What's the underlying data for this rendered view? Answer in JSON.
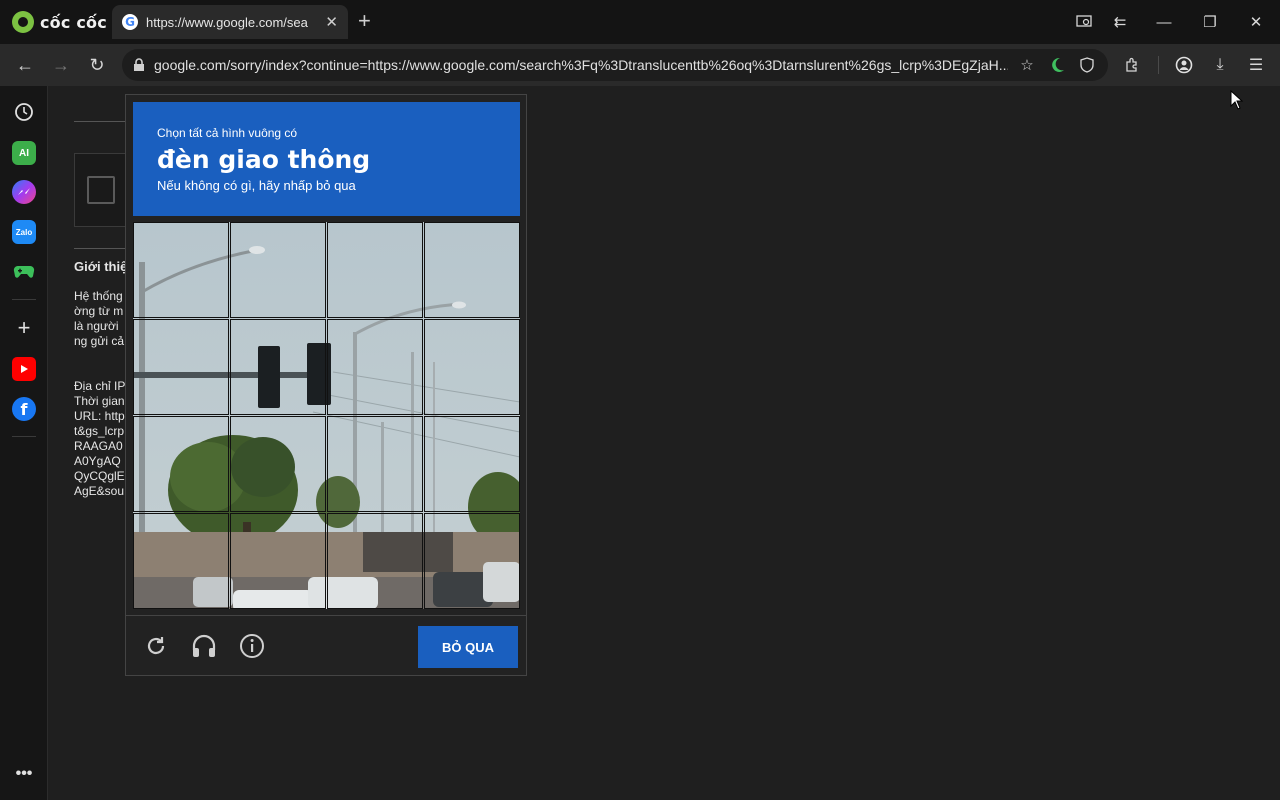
{
  "browser": {
    "brand": "cốc cốc",
    "tab_title": "https://www.google.com/sea",
    "url": "google.com/sorry/index?continue=https://www.google.com/search%3Fq%3Dtranslucenttb%26oq%3Dtarnslurent%26gs_lcrp%3DEgZjaH..."
  },
  "page": {
    "heading": "Giới thiệ",
    "para1": [
      "Hệ thống",
      "ờng từ m",
      "là người",
      "ng gửi cả"
    ],
    "para2": [
      "Địa chỉ IP",
      "Thời gian",
      "URL: http",
      "t&gs_lcrp",
      "RAAGA0",
      "A0YgAQ",
      "QyCQglE",
      "AgE&sou"
    ]
  },
  "captcha": {
    "instruction_pre": "Chọn tất cả hình vuông có",
    "instruction_main": "đèn giao thông",
    "instruction_sub": "Nếu không có gì, hãy nhấp bỏ qua",
    "skip_label": "BỎ QUA",
    "grid_rows": 4,
    "grid_cols": 4
  },
  "colors": {
    "captcha_blue": "#1a5fbf",
    "brand_green": "#7cc242"
  },
  "icons": {
    "reload": "reload-icon",
    "audio": "headphones-icon",
    "info": "info-icon"
  }
}
